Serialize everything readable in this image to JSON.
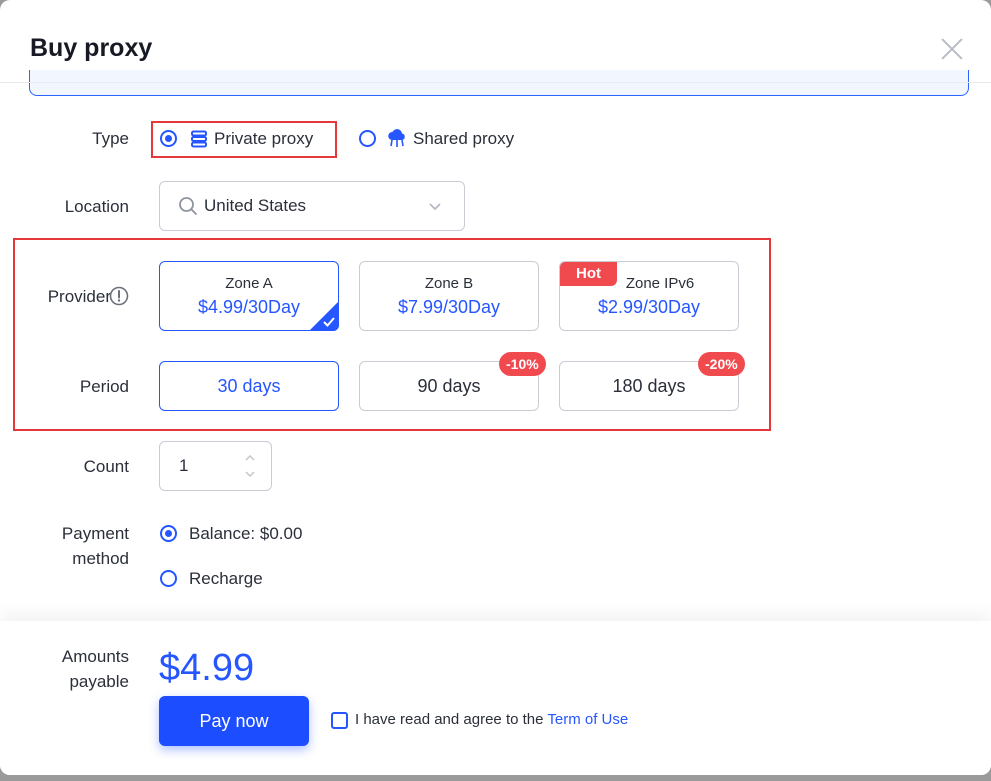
{
  "dialog": {
    "title": "Buy proxy"
  },
  "type": {
    "label": "Type",
    "options": [
      {
        "label": "Private proxy",
        "icon": "server-icon",
        "selected": true
      },
      {
        "label": "Shared proxy",
        "icon": "cloud-network-icon",
        "selected": false
      }
    ]
  },
  "location": {
    "label": "Location",
    "value": "United States",
    "icon": "search-icon"
  },
  "provider": {
    "label": "Provider",
    "zones": [
      {
        "name": "Zone A",
        "price": "$4.99/30Day",
        "selected": true
      },
      {
        "name": "Zone B",
        "price": "$7.99/30Day",
        "selected": false
      },
      {
        "name": "Zone IPv6",
        "price": "$2.99/30Day",
        "selected": false,
        "badge": "Hot"
      }
    ]
  },
  "period": {
    "label": "Period",
    "options": [
      {
        "label": "30 days",
        "selected": true
      },
      {
        "label": "90 days",
        "selected": false,
        "badge": "-10%"
      },
      {
        "label": "180 days",
        "selected": false,
        "badge": "-20%"
      }
    ]
  },
  "count": {
    "label": "Count",
    "value": "1"
  },
  "payment": {
    "label_line1": "Payment",
    "label_line2": "method",
    "options": [
      {
        "label": "Balance: $0.00",
        "selected": true
      },
      {
        "label": "Recharge",
        "selected": false
      }
    ]
  },
  "footer": {
    "label_line1": "Amounts",
    "label_line2": "payable",
    "amount": "$4.99",
    "pay_label": "Pay now",
    "agree_text": "I have read and agree to the ",
    "term_link": "Term of Use"
  },
  "colors": {
    "accent": "#2556ff",
    "badge": "#f04a4f",
    "highlight": "#e5383b"
  }
}
